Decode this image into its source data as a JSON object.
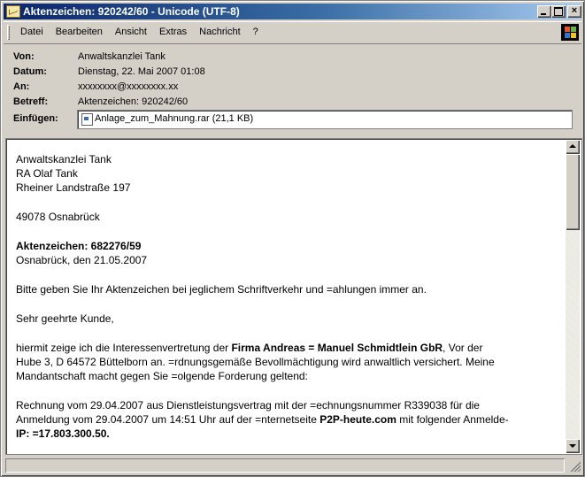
{
  "window": {
    "title": "Aktenzeichen: 920242/60 - Unicode (UTF-8)",
    "controls": {
      "minimize": "_",
      "maximize": "□",
      "close": "×"
    }
  },
  "menu": {
    "items": [
      "Datei",
      "Bearbeiten",
      "Ansicht",
      "Extras",
      "Nachricht",
      "?"
    ]
  },
  "header": {
    "from_label": "Von:",
    "from_value": "Anwaltskanzlei Tank",
    "date_label": "Datum:",
    "date_value": "Dienstag, 22. Mai 2007 01:08",
    "to_label": "An:",
    "to_value": "xxxxxxxx@xxxxxxxx.xx",
    "subject_label": "Betreff:",
    "subject_value": "Aktenzeichen: 920242/60",
    "attach_label": "Einfügen:",
    "attach_value": "Anlage_zum_Mahnung.rar (21,1 KB)"
  },
  "body": {
    "sender_line1": "Anwaltskanzlei Tank",
    "sender_line2": "RA Olaf Tank",
    "sender_line3": "Rheiner Landstraße 197",
    "sender_city": "49078 Osnabrück",
    "ref_label": "Aktenzeichen: 682276/59",
    "place_date": "Osnabrück, den 21.05.2007",
    "request": "Bitte geben Sie Ihr Aktenzeichen bei jeglichem Schriftverkehr und =ahlungen immer an.",
    "salutation": "Sehr geehrte Kunde,",
    "p1_a": "hiermit zeige ich die Interessenvertretung der ",
    "p1_b": "Firma Andreas = Manuel Schmidtlein GbR",
    "p1_c": ", Vor der",
    "p1_line2": "Hube 3, D 64572 Büttelborn an. =rdnungsgemäße Bevollmächtigung wird anwaltlich versichert. Meine",
    "p1_line3": "Mandantschaft macht gegen Sie =olgende Forderung geltend:",
    "p2_line1": "Rechnung vom 29.04.2007 aus Dienstleistungsvertrag mit der =echnungsnummer R339038 für die",
    "p2_line2_a": "Anmeldung vom 29.04.2007 um 14:51 Uhr auf der =nternetseite ",
    "p2_line2_b": "P2P-heute.com",
    "p2_line2_c": " mit folgender Anmelde-",
    "p2_line3": "IP: =17.803.300.50."
  }
}
